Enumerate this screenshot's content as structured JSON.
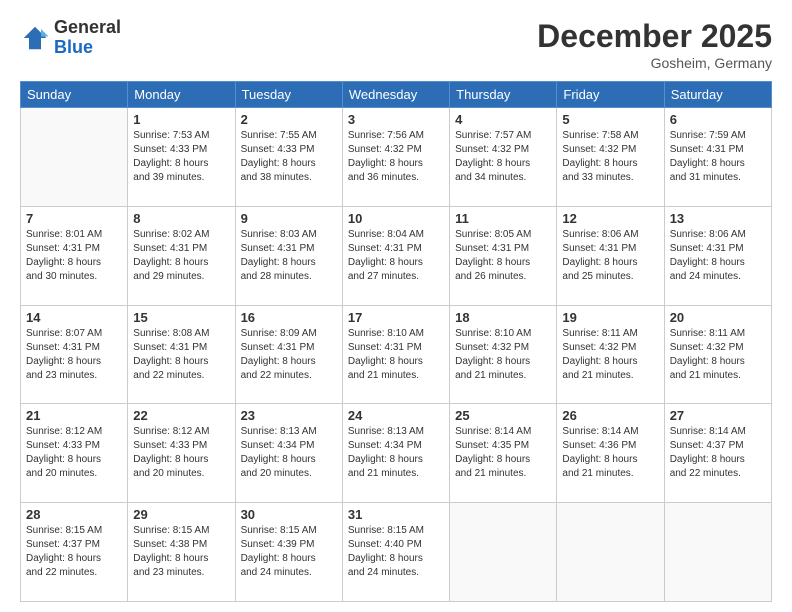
{
  "header": {
    "logo_line1": "General",
    "logo_line2": "Blue",
    "month": "December 2025",
    "location": "Gosheim, Germany"
  },
  "weekdays": [
    "Sunday",
    "Monday",
    "Tuesday",
    "Wednesday",
    "Thursday",
    "Friday",
    "Saturday"
  ],
  "weeks": [
    [
      {
        "day": "",
        "info": ""
      },
      {
        "day": "1",
        "info": "Sunrise: 7:53 AM\nSunset: 4:33 PM\nDaylight: 8 hours\nand 39 minutes."
      },
      {
        "day": "2",
        "info": "Sunrise: 7:55 AM\nSunset: 4:33 PM\nDaylight: 8 hours\nand 38 minutes."
      },
      {
        "day": "3",
        "info": "Sunrise: 7:56 AM\nSunset: 4:32 PM\nDaylight: 8 hours\nand 36 minutes."
      },
      {
        "day": "4",
        "info": "Sunrise: 7:57 AM\nSunset: 4:32 PM\nDaylight: 8 hours\nand 34 minutes."
      },
      {
        "day": "5",
        "info": "Sunrise: 7:58 AM\nSunset: 4:32 PM\nDaylight: 8 hours\nand 33 minutes."
      },
      {
        "day": "6",
        "info": "Sunrise: 7:59 AM\nSunset: 4:31 PM\nDaylight: 8 hours\nand 31 minutes."
      }
    ],
    [
      {
        "day": "7",
        "info": "Sunrise: 8:01 AM\nSunset: 4:31 PM\nDaylight: 8 hours\nand 30 minutes."
      },
      {
        "day": "8",
        "info": "Sunrise: 8:02 AM\nSunset: 4:31 PM\nDaylight: 8 hours\nand 29 minutes."
      },
      {
        "day": "9",
        "info": "Sunrise: 8:03 AM\nSunset: 4:31 PM\nDaylight: 8 hours\nand 28 minutes."
      },
      {
        "day": "10",
        "info": "Sunrise: 8:04 AM\nSunset: 4:31 PM\nDaylight: 8 hours\nand 27 minutes."
      },
      {
        "day": "11",
        "info": "Sunrise: 8:05 AM\nSunset: 4:31 PM\nDaylight: 8 hours\nand 26 minutes."
      },
      {
        "day": "12",
        "info": "Sunrise: 8:06 AM\nSunset: 4:31 PM\nDaylight: 8 hours\nand 25 minutes."
      },
      {
        "day": "13",
        "info": "Sunrise: 8:06 AM\nSunset: 4:31 PM\nDaylight: 8 hours\nand 24 minutes."
      }
    ],
    [
      {
        "day": "14",
        "info": "Sunrise: 8:07 AM\nSunset: 4:31 PM\nDaylight: 8 hours\nand 23 minutes."
      },
      {
        "day": "15",
        "info": "Sunrise: 8:08 AM\nSunset: 4:31 PM\nDaylight: 8 hours\nand 22 minutes."
      },
      {
        "day": "16",
        "info": "Sunrise: 8:09 AM\nSunset: 4:31 PM\nDaylight: 8 hours\nand 22 minutes."
      },
      {
        "day": "17",
        "info": "Sunrise: 8:10 AM\nSunset: 4:31 PM\nDaylight: 8 hours\nand 21 minutes."
      },
      {
        "day": "18",
        "info": "Sunrise: 8:10 AM\nSunset: 4:32 PM\nDaylight: 8 hours\nand 21 minutes."
      },
      {
        "day": "19",
        "info": "Sunrise: 8:11 AM\nSunset: 4:32 PM\nDaylight: 8 hours\nand 21 minutes."
      },
      {
        "day": "20",
        "info": "Sunrise: 8:11 AM\nSunset: 4:32 PM\nDaylight: 8 hours\nand 21 minutes."
      }
    ],
    [
      {
        "day": "21",
        "info": "Sunrise: 8:12 AM\nSunset: 4:33 PM\nDaylight: 8 hours\nand 20 minutes."
      },
      {
        "day": "22",
        "info": "Sunrise: 8:12 AM\nSunset: 4:33 PM\nDaylight: 8 hours\nand 20 minutes."
      },
      {
        "day": "23",
        "info": "Sunrise: 8:13 AM\nSunset: 4:34 PM\nDaylight: 8 hours\nand 20 minutes."
      },
      {
        "day": "24",
        "info": "Sunrise: 8:13 AM\nSunset: 4:34 PM\nDaylight: 8 hours\nand 21 minutes."
      },
      {
        "day": "25",
        "info": "Sunrise: 8:14 AM\nSunset: 4:35 PM\nDaylight: 8 hours\nand 21 minutes."
      },
      {
        "day": "26",
        "info": "Sunrise: 8:14 AM\nSunset: 4:36 PM\nDaylight: 8 hours\nand 21 minutes."
      },
      {
        "day": "27",
        "info": "Sunrise: 8:14 AM\nSunset: 4:37 PM\nDaylight: 8 hours\nand 22 minutes."
      }
    ],
    [
      {
        "day": "28",
        "info": "Sunrise: 8:15 AM\nSunset: 4:37 PM\nDaylight: 8 hours\nand 22 minutes."
      },
      {
        "day": "29",
        "info": "Sunrise: 8:15 AM\nSunset: 4:38 PM\nDaylight: 8 hours\nand 23 minutes."
      },
      {
        "day": "30",
        "info": "Sunrise: 8:15 AM\nSunset: 4:39 PM\nDaylight: 8 hours\nand 24 minutes."
      },
      {
        "day": "31",
        "info": "Sunrise: 8:15 AM\nSunset: 4:40 PM\nDaylight: 8 hours\nand 24 minutes."
      },
      {
        "day": "",
        "info": ""
      },
      {
        "day": "",
        "info": ""
      },
      {
        "day": "",
        "info": ""
      }
    ]
  ]
}
